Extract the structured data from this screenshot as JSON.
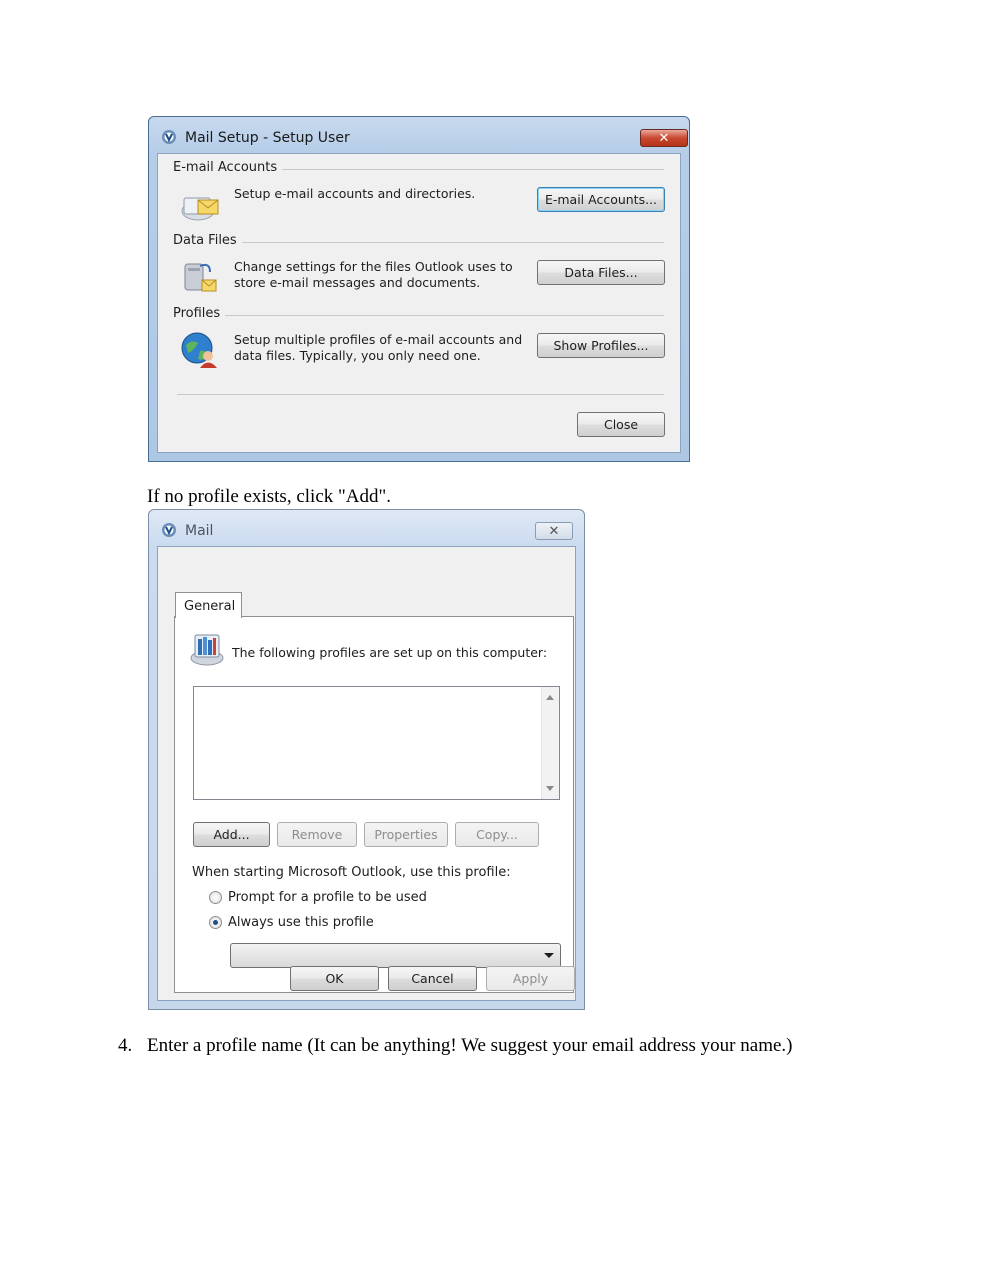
{
  "setup_dialog": {
    "title": "Mail Setup - Setup User",
    "email_group_label": "E-mail Accounts",
    "email_desc": "Setup e-mail accounts and directories.",
    "email_button": "E-mail Accounts...",
    "data_group_label": "Data Files",
    "data_desc": "Change settings for the files Outlook uses to store e-mail messages and documents.",
    "data_button": "Data Files...",
    "profiles_group_label": "Profiles",
    "profiles_desc": "Setup multiple profiles of e-mail accounts and data files. Typically, you only need one.",
    "profiles_button": "Show Profiles...",
    "close_button": "Close"
  },
  "caption": "If no profile exists, click \"Add\".",
  "mail_dialog": {
    "title": "Mail",
    "tab_general": "General",
    "profiles_heading": "The following profiles are set up on this computer:",
    "buttons": {
      "add": "Add...",
      "remove": "Remove",
      "properties": "Properties",
      "copy": "Copy..."
    },
    "startup_label": "When starting Microsoft Outlook, use this profile:",
    "radio_prompt": "Prompt for a profile to be used",
    "radio_always": "Always use this profile",
    "selected_option": "Always use this profile",
    "ok": "OK",
    "cancel": "Cancel",
    "apply": "Apply"
  },
  "step": {
    "number": "4.",
    "text": "Enter a profile name (It can be anything! We suggest your email address your name.)"
  }
}
